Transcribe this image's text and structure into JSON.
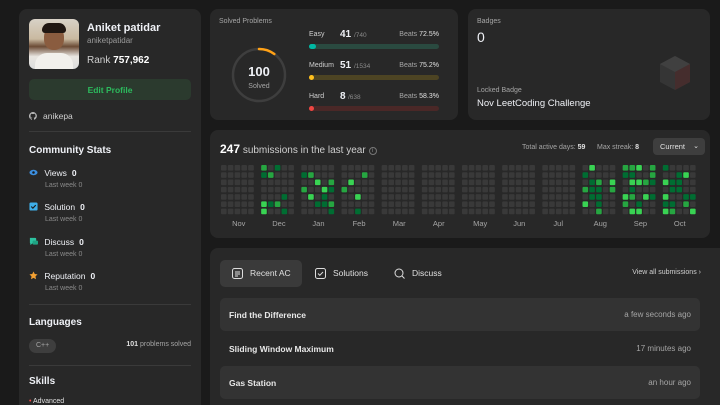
{
  "profile": {
    "name": "Aniket patidar",
    "handle": "aniketpatidar",
    "rank_label": "Rank",
    "rank": "757,962",
    "edit_label": "Edit Profile",
    "github": "anikepa"
  },
  "community": {
    "title": "Community Stats",
    "items": [
      {
        "label": "Views",
        "value": "0",
        "sub": "Last week",
        "sub_val": "0"
      },
      {
        "label": "Solution",
        "value": "0",
        "sub": "Last week",
        "sub_val": "0"
      },
      {
        "label": "Discuss",
        "value": "0",
        "sub": "Last week",
        "sub_val": "0"
      },
      {
        "label": "Reputation",
        "value": "0",
        "sub": "Last week",
        "sub_val": "0"
      }
    ]
  },
  "languages": {
    "title": "Languages",
    "lang": "C++",
    "count": "101",
    "count_label": "problems solved"
  },
  "skills": {
    "title": "Skills",
    "first": "Advanced"
  },
  "solved": {
    "title": "Solved Problems",
    "total": "100",
    "total_label": "Solved",
    "ring_fraction": 0.1,
    "levels": [
      {
        "name": "Easy",
        "count": "41",
        "total": "/740",
        "beats_label": "Beats",
        "beats": "72.5%",
        "fraction": 0.055,
        "color": "#00b8a3",
        "track": "#2a4a40"
      },
      {
        "name": "Medium",
        "count": "51",
        "total": "/1534",
        "beats_label": "Beats",
        "beats": "75.2%",
        "fraction": 0.033,
        "color": "#ffc01e",
        "track": "#4d4423"
      },
      {
        "name": "Hard",
        "count": "8",
        "total": "/638",
        "beats_label": "Beats",
        "beats": "58.3%",
        "fraction": 0.013,
        "color": "#ef4743",
        "track": "#4a2827"
      }
    ]
  },
  "badges": {
    "label": "Badges",
    "count": "0",
    "locked_label": "Locked Badge",
    "locked_name": "Nov LeetCoding Challenge"
  },
  "submissions": {
    "count": "247",
    "label": "submissions in the last year",
    "active_label": "Total active days:",
    "active": "59",
    "streak_label": "Max streak:",
    "streak": "8",
    "period": "Current",
    "months": [
      "Nov",
      "Dec",
      "Jan",
      "Feb",
      "Mar",
      "Apr",
      "May",
      "Jun",
      "Jul",
      "Aug",
      "Sep",
      "Oct"
    ]
  },
  "recent": {
    "tabs": [
      "Recent AC",
      "Solutions",
      "Discuss"
    ],
    "view_all": "View all submissions",
    "items": [
      {
        "title": "Find the Difference",
        "time": "a few seconds ago"
      },
      {
        "title": "Sliding Window Maximum",
        "time": "17 minutes ago"
      },
      {
        "title": "Gas Station",
        "time": "an hour ago"
      }
    ]
  },
  "colors": {
    "accent": "#2cbb5d",
    "panel": "#282828",
    "bg": "#1a1a1a"
  }
}
